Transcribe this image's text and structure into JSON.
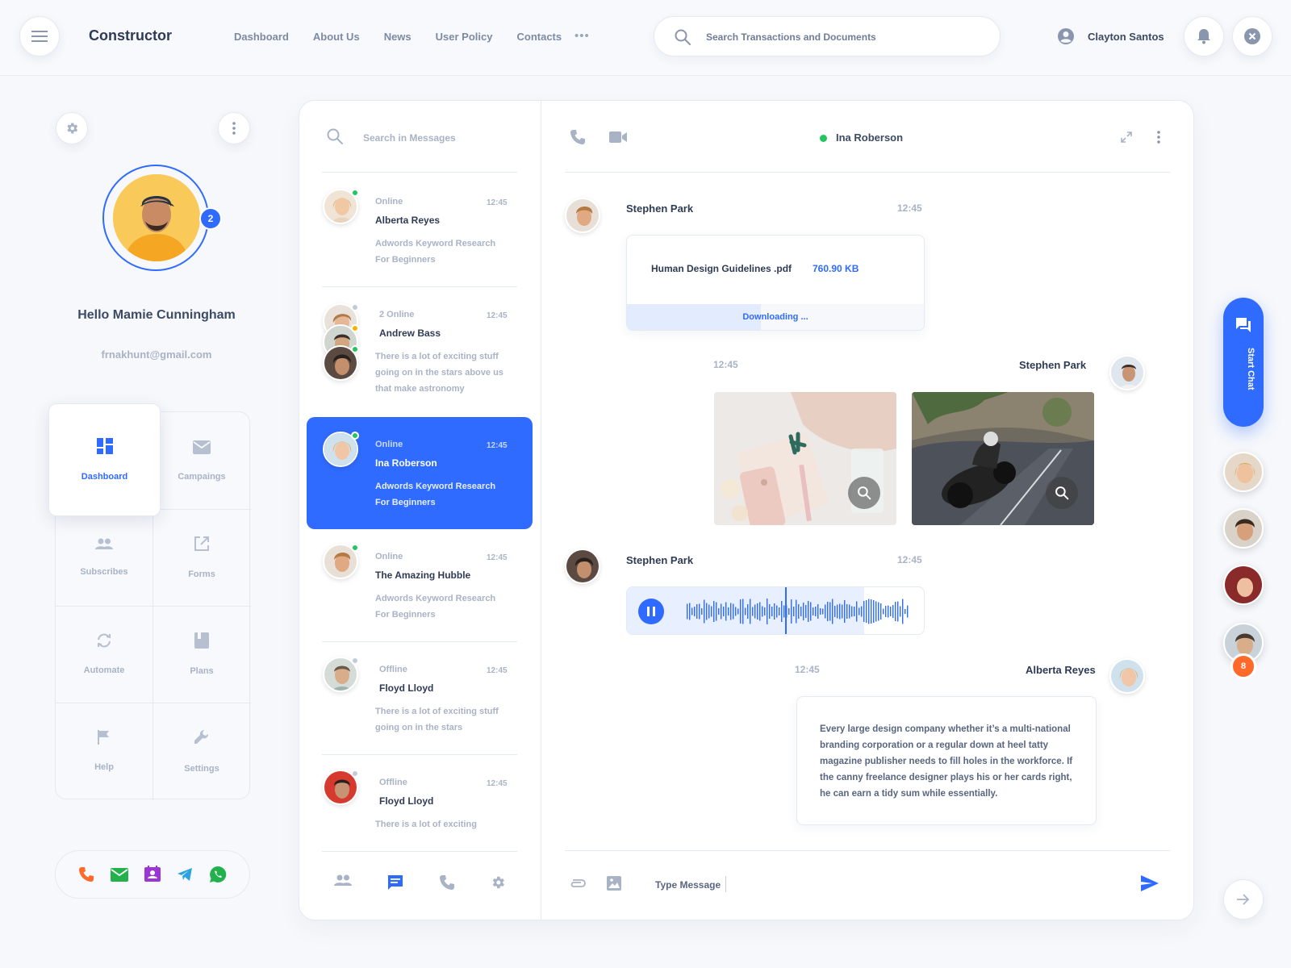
{
  "header": {
    "brand": "Constructor",
    "nav": [
      "Dashboard",
      "About Us",
      "News",
      "User Policy",
      "Contacts"
    ],
    "more": "•••",
    "search_placeholder": "Search Transactions and Documents",
    "user_name": "Clayton Santos"
  },
  "profile": {
    "greeting": "Hello Mamie Cunningham",
    "email": "frnakhunt@gmail.com",
    "badge": "2"
  },
  "menu": {
    "dashboard": "Dashboard",
    "campaigns": "Campaings",
    "subscribes": "Subscribes",
    "forms": "Forms",
    "automate": "Automate",
    "plans": "Plans",
    "help": "Help",
    "settings": "Settings"
  },
  "messages": {
    "search_placeholder": "Search in Messages",
    "conversations": [
      {
        "status": "Online",
        "time": "12:45",
        "name": "Alberta Reyes",
        "preview": "Adwords Keyword Research For Beginners"
      },
      {
        "status": "2 Online",
        "time": "12:45",
        "name": "Andrew Bass",
        "preview": "There is a lot of exciting stuff going on in the stars above us that make astronomy"
      },
      {
        "status": "Online",
        "time": "12:45",
        "name": "Ina Roberson",
        "preview": "Adwords Keyword Research For Beginners"
      },
      {
        "status": "Online",
        "time": "12:45",
        "name": "The Amazing Hubble",
        "preview": "Adwords Keyword Research For Beginners"
      },
      {
        "status": "Offline",
        "time": "12:45",
        "name": "Floyd Lloyd",
        "preview": "There is a lot of exciting stuff going on in the stars"
      },
      {
        "status": "Offline",
        "time": "12:45",
        "name": "Floyd Lloyd",
        "preview": "There is a lot of exciting"
      }
    ]
  },
  "chat": {
    "contact_name": "Ina Roberson",
    "msg1": {
      "sender": "Stephen Park",
      "time": "12:45",
      "file_name": "Human Design Guidelines .pdf",
      "file_size": "760.90 KB",
      "download_label": "Downloading ...",
      "download_progress": 0.45
    },
    "msg2": {
      "sender": "Stephen Park",
      "time": "12:45"
    },
    "msg3": {
      "sender": "Stephen Park",
      "time": "12:45",
      "audio_progress": 0.8
    },
    "msg4": {
      "sender": "Alberta Reyes",
      "time": "12:45",
      "text": "Every large design company whether it’s a multi-national branding corporation or a regular down at heel tatty magazine publisher needs to fill holes in the workforce. If the canny freelance designer plays his or her cards right, he can earn a tidy sum while essentially."
    },
    "composer_placeholder": "Type Message"
  },
  "rail": {
    "start_chat": "Start Chat",
    "badge": "8"
  },
  "colors": {
    "accent": "#2f6bff",
    "online": "#22c55e",
    "away": "#f5b400",
    "offline": "#c4cad6",
    "badge_orange": "#ff6a2b"
  }
}
